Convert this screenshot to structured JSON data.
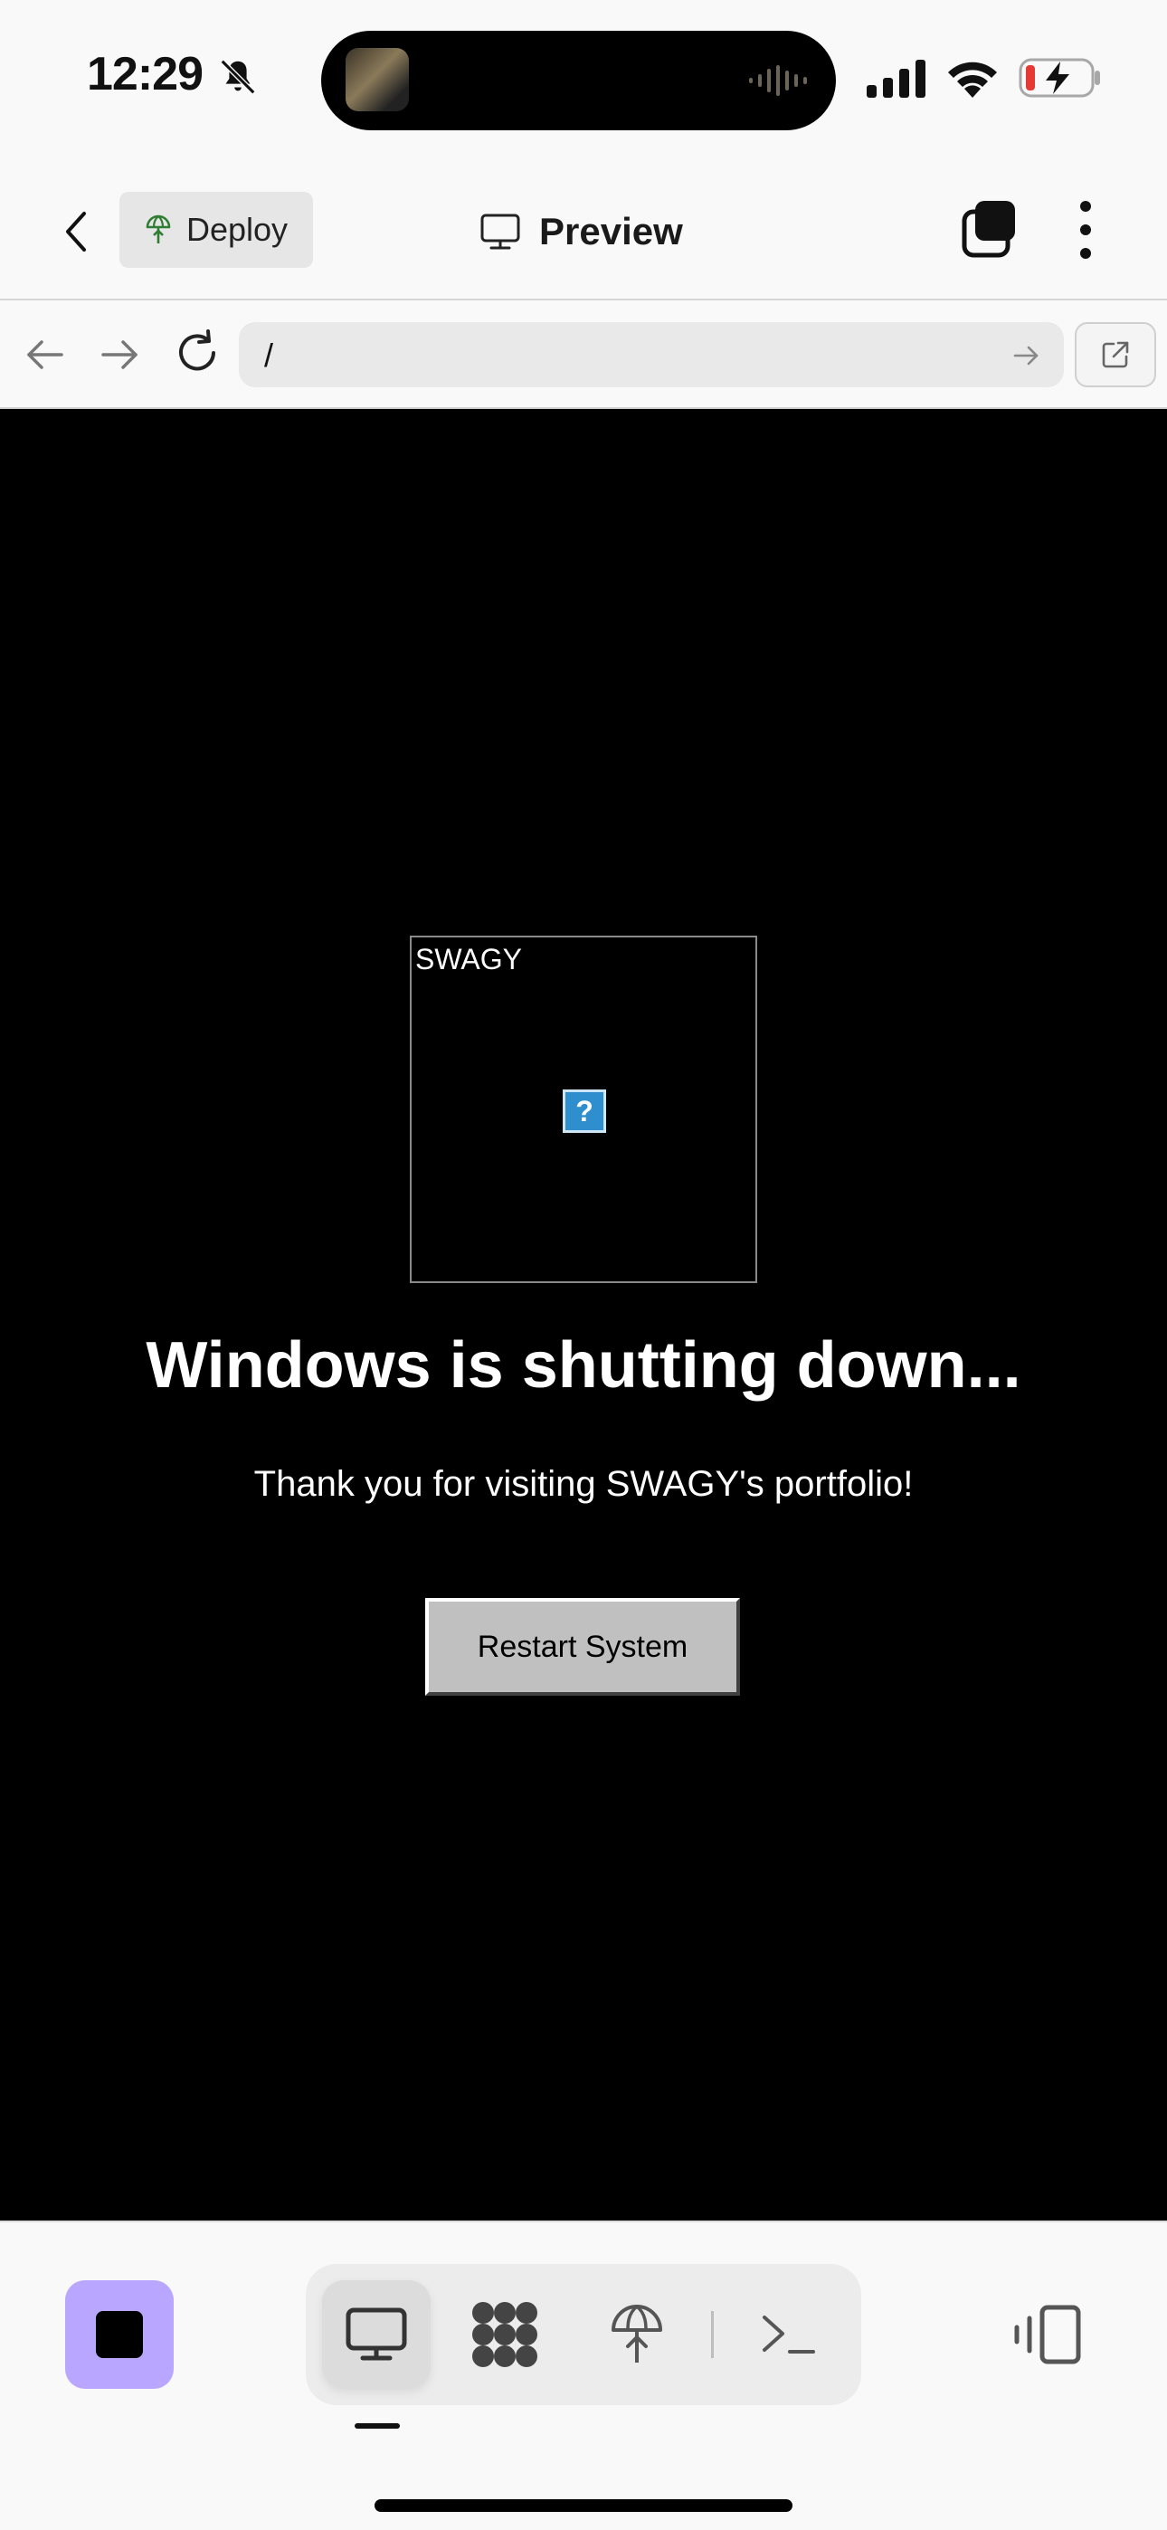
{
  "status_bar": {
    "time": "12:29"
  },
  "top_nav": {
    "deploy_label": "Deploy",
    "title": "Preview"
  },
  "address_bar": {
    "url": "/"
  },
  "page": {
    "logo_text": "SWAGY",
    "broken_image_glyph": "?",
    "headline": "Windows is shutting down...",
    "subline": "Thank you for visiting SWAGY's portfolio!",
    "restart_label": "Restart System"
  },
  "toolbar": {
    "items": [
      "preview",
      "extensions",
      "deploy",
      "shell"
    ],
    "active": "preview"
  },
  "colors": {
    "accent": "#b9a6ff",
    "page_bg": "#000000",
    "deploy_icon": "#2e7d32",
    "battery_low": "#e53935"
  },
  "icons": [
    "bell-off-icon",
    "signal-icon",
    "wifi-icon",
    "battery-charging-icon",
    "chevron-left-icon",
    "deploy-icon",
    "monitor-icon",
    "tabs-icon",
    "more-vertical-icon",
    "arrow-left-icon",
    "arrow-right-icon",
    "reload-icon",
    "open-external-icon",
    "stop-icon",
    "extensions-icon",
    "terminal-icon",
    "layout-toggle-icon"
  ]
}
